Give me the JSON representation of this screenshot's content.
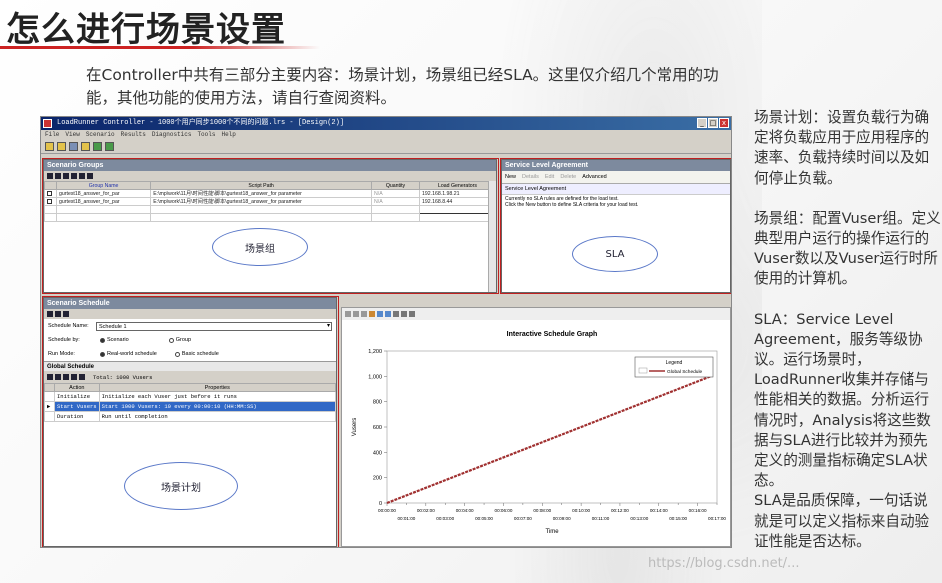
{
  "slide": {
    "title": "怎么进行场景设置",
    "intro": "在Controller中共有三部分主要内容：场景计划，场景组已经SLA。这里仅介绍几个常用的功能，其他功能的使用方法，请自行查阅资料。",
    "right_paragraphs": [
      "场景计划：设置负载行为确定将负载应用于应用程序的速率、负载持续时间以及如何停止负载。",
      "场景组：配置Vuser组。定义典型用户运行的操作运行的Vuser数以及Vuser运行时所使用的计算机。",
      "SLA：Service Level Agreement，服务等级协议。运行场景时，LoadRunner收集并存储与性能相关的数据。分析运行情况时，Analysis将这些数据与SLA进行比较并为预先定义的测量指标确定SLA状态。",
      "SLA是品质保障，一句话说就是可以定义指标来自动验证性能是否达标。"
    ],
    "watermark": "https://blog.csdn.net/..."
  },
  "window": {
    "title": "LoadRunner Controller - 1000个用户同步1000个不同的问题.lrs - [Design(2)]",
    "menu": [
      "File",
      "View",
      "Scenario",
      "Results",
      "Diagnostics",
      "Tools",
      "Help"
    ],
    "buttons": {
      "minimize": "_",
      "maximize": "□",
      "close": "x"
    }
  },
  "groups": {
    "header": "Scenario Groups",
    "columns": [
      "Group Name",
      "Script Path",
      "Quantity",
      "Load Generators"
    ],
    "rows": [
      {
        "name": "gurtest18_answer_for_par",
        "path": "E:\\mp\\work\\11月\\时间性能\\脚本\\gurtest18_answer_for parameter",
        "qty": "N/A",
        "lg": "192.168.1.98.21"
      },
      {
        "name": "gurtest18_answer_for_par",
        "path": "E:\\mp\\work\\11月\\时间性能\\脚本\\gurtest18_answer_for parameter",
        "qty": "N/A",
        "lg": "192.168.8.44"
      }
    ],
    "cloud_label": "场景组"
  },
  "sla": {
    "header": "Service Level Agreement",
    "buttons": [
      "New",
      "Details",
      "Edit",
      "Delete",
      "Advanced"
    ],
    "section_title": "Service Level Agreement",
    "lines": [
      "Currently no SLA rules are defined for the load test.",
      "Click the New button to define SLA criteria for your load test."
    ],
    "cloud_label": "SLA"
  },
  "schedule": {
    "header": "Scenario Schedule",
    "name_label": "Schedule Name:",
    "name_value": "Schedule 1",
    "by_label": "Schedule by:",
    "by_options": [
      "Scenario",
      "Group"
    ],
    "mode_label": "Run Mode:",
    "mode_options": [
      "Real-world schedule",
      "Basic schedule"
    ],
    "global_title": "Global Schedule",
    "total": "Total: 1000 Vusers",
    "columns": [
      "Action",
      "Properties"
    ],
    "rows": [
      {
        "action": "Initialize",
        "props": "Initialize each Vuser just before it runs"
      },
      {
        "action": "Start  Vusers",
        "props": "Start 1000 Vusers: 10 every 00:00:10 (HH:MM:SS)"
      },
      {
        "action": "Duration",
        "props": "Run until completion"
      }
    ],
    "cloud_label": "场景计划"
  },
  "chart_data": {
    "type": "line",
    "title": "Interactive Schedule Graph",
    "xlabel": "Time",
    "ylabel": "Vusers",
    "y_ticks": [
      "0",
      "200",
      "400",
      "600",
      "800",
      "1,000",
      "1,200"
    ],
    "x_ticks_top": [
      "00:00:00",
      "00:02:00",
      "00:04:00",
      "00:06:00",
      "00:08:00",
      "00:10:00",
      "00:12:00",
      "00:14:00",
      "00:16:00"
    ],
    "x_ticks_bottom": [
      "00:01:00",
      "00:03:00",
      "00:05:00",
      "00:07:00",
      "00:09:00",
      "00:11:00",
      "00:13:00",
      "00:15:00",
      "00:17:00"
    ],
    "ylim": [
      0,
      1200
    ],
    "xlim_minutes": [
      0,
      17
    ],
    "legend_title": "Legend",
    "series": [
      {
        "name": "Global Schedule",
        "x_minutes": [
          0,
          16.67
        ],
        "values": [
          0,
          1000
        ]
      }
    ],
    "line_color": "#a03030"
  }
}
